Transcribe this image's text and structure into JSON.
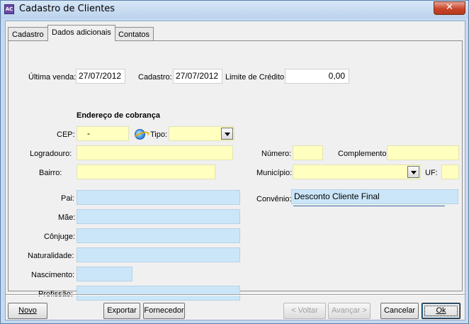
{
  "window": {
    "icon_text": "AC",
    "title": "Cadastro de Clientes",
    "close_glyph": "✕"
  },
  "tabs": [
    "Cadastro",
    "Dados adicionais",
    "Contatos"
  ],
  "active_tab": "Dados adicionais",
  "top_row": {
    "ultima_venda_label": "Última venda:",
    "ultima_venda_value": "27/07/2012",
    "cadastro_label": "Cadastro:",
    "cadastro_value": "27/07/2012",
    "limite_label": "Limite de Crédito:",
    "limite_value": "0,00"
  },
  "endereco": {
    "section_title": "Endereço de cobrança",
    "cep_label": "CEP:",
    "cep_value": "-",
    "tipo_label": "Tipo:",
    "tipo_value": "",
    "logradouro_label": "Logradouro:",
    "logradouro_value": "",
    "numero_label": "Número:",
    "numero_value": "",
    "complemento_label": "Complemento:",
    "complemento_value": "",
    "bairro_label": "Bairro:",
    "bairro_value": "",
    "municipio_label": "Município:",
    "municipio_value": "",
    "uf_label": "UF:",
    "uf_value": ""
  },
  "pessoais": {
    "pai_label": "Pai:",
    "mae_label": "Mãe:",
    "conjuge_label": "Cônjuge:",
    "naturalidade_label": "Naturalidade:",
    "nascimento_label": "Nascimento:",
    "profissao_label": "Profissão:",
    "convenio_label": "Convênio:",
    "convenio_value": "Desconto Cliente Final"
  },
  "buttons": {
    "novo": "Novo",
    "exportar": "Exportar",
    "fornecedor": "Fornecedor",
    "voltar": "< Voltar",
    "avancar": "Avançar >",
    "cancelar": "Cancelar",
    "ok": "Ok"
  }
}
